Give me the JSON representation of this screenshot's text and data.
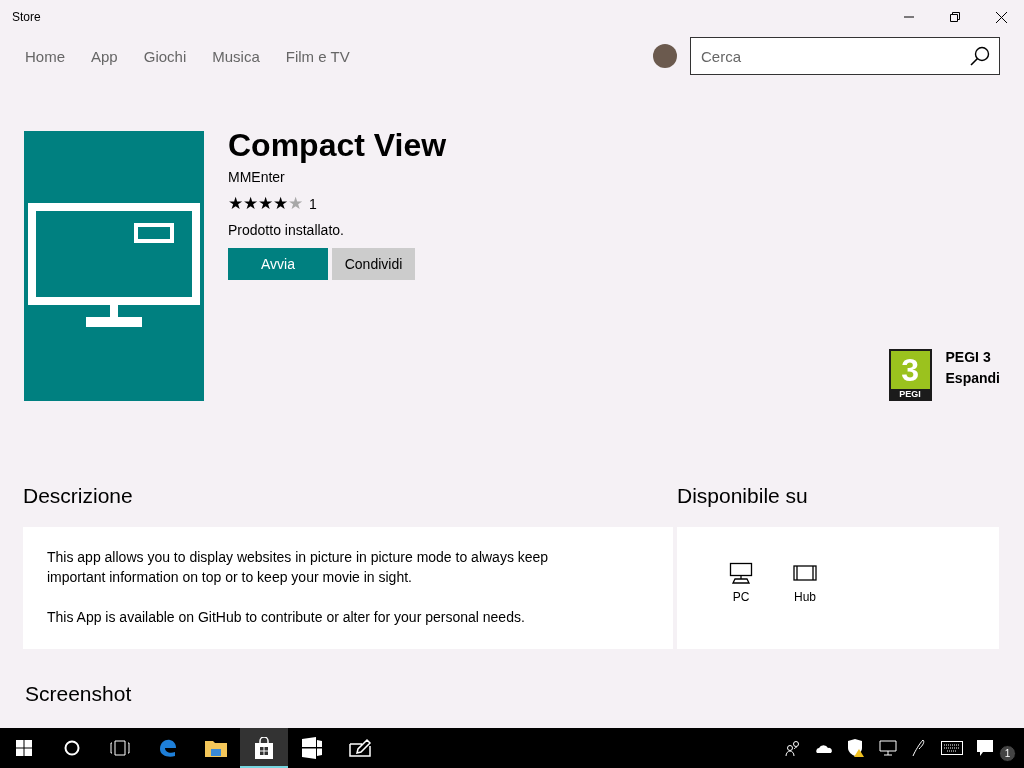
{
  "window": {
    "title": "Store"
  },
  "nav": [
    "Home",
    "App",
    "Giochi",
    "Musica",
    "Film e TV"
  ],
  "search": {
    "placeholder": "Cerca"
  },
  "app": {
    "title": "Compact View",
    "publisher": "MMEnter",
    "stars": 4,
    "rating_count": "1",
    "status": "Prodotto installato.",
    "buttons": [
      {
        "label": "Avvia",
        "kind": "primary"
      },
      {
        "label": "Condividi",
        "kind": "secondary"
      }
    ]
  },
  "age_rating": {
    "badge_number": "3",
    "badge_label": "PEGI",
    "title": "PEGI 3",
    "link": "Espandi"
  },
  "description": {
    "heading": "Descrizione",
    "paragraphs": [
      "This app allows you to display websites in picture in picture mode to always keep important information on top or to keep your movie in sight.",
      "This App is available on GitHub to contribute or alter for your personal needs."
    ]
  },
  "availability": {
    "heading": "Disponibile su",
    "devices": [
      {
        "label": "PC",
        "kind": "pc"
      },
      {
        "label": "Hub",
        "kind": "hub"
      }
    ]
  },
  "screenshots": {
    "heading": "Screenshot"
  },
  "taskbar": {
    "apps": [
      {
        "kind": "edge",
        "selected": false
      },
      {
        "kind": "explorer",
        "selected": false
      },
      {
        "kind": "store",
        "selected": true
      },
      {
        "kind": "tablet",
        "selected": false
      },
      {
        "kind": "ink",
        "selected": false
      }
    ],
    "notification_count": "1"
  }
}
